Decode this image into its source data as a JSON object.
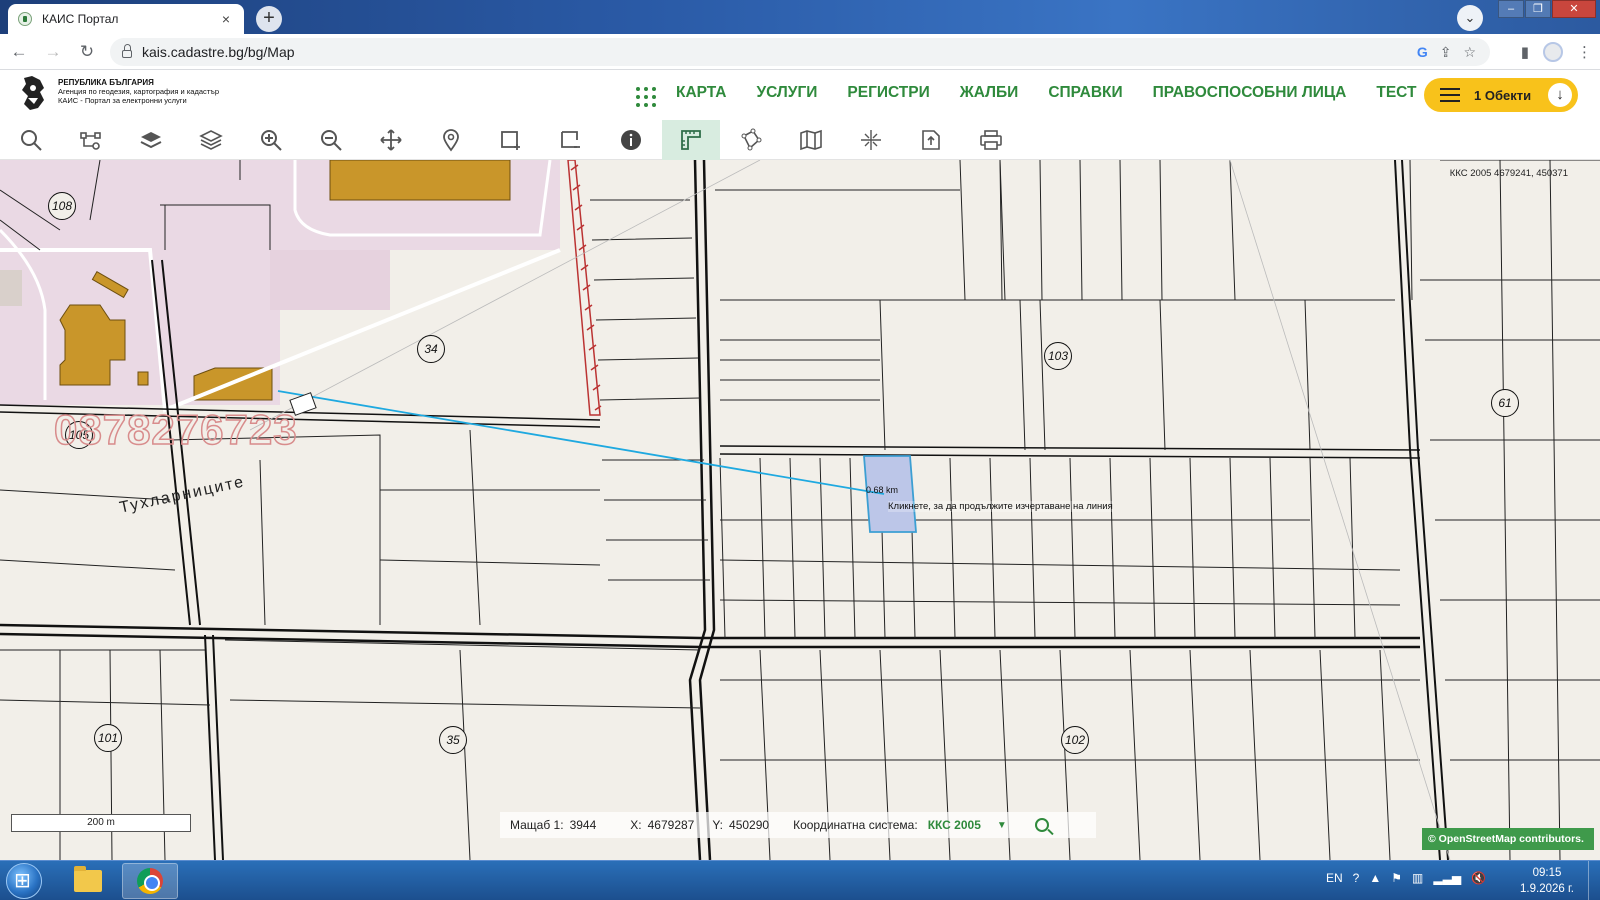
{
  "browser": {
    "tab_title": "КАИС Портал",
    "tab_close": "×",
    "new_tab": "+",
    "tab_search": "⌄",
    "window_controls": [
      "–",
      "❐",
      "✕"
    ],
    "url": "kais.cadastre.bg/bg/Map"
  },
  "site": {
    "logo_line1": "РЕПУБЛИКА БЪЛГАРИЯ",
    "logo_line2": "Агенция по геодезия, картография и кадастър",
    "logo_line3": "КАИС - Портал за електронни услуги",
    "nav": [
      "КАРТА",
      "УСЛУГИ",
      "РЕГИСТРИ",
      "ЖАЛБИ",
      "СПРАВКИ",
      "ПРАВОСПОСОБНИ ЛИЦА",
      "ТЕСТ"
    ],
    "objects_button": "1 Обекти",
    "accent": "#2f8a3c",
    "objects_color": "#f8c21b"
  },
  "toolbar": {
    "tools": [
      {
        "name": "search-tool",
        "icon": "magnifier-icon"
      },
      {
        "name": "route-tool",
        "icon": "nodes-icon"
      },
      {
        "name": "layers-tool",
        "icon": "layers-filled-icon"
      },
      {
        "name": "layers-list-tool",
        "icon": "layers-outline-icon"
      },
      {
        "name": "zoom-in-tool",
        "icon": "zoom-in-icon"
      },
      {
        "name": "zoom-out-tool",
        "icon": "zoom-out-icon"
      },
      {
        "name": "pan-tool",
        "icon": "move-icon"
      },
      {
        "name": "place-marker-tool",
        "icon": "pin-icon"
      },
      {
        "name": "select-add-tool",
        "icon": "select-plus-icon"
      },
      {
        "name": "select-remove-tool",
        "icon": "select-minus-icon"
      },
      {
        "name": "info-tool",
        "icon": "info-icon"
      },
      {
        "name": "measure-tool",
        "icon": "ruler-icon"
      },
      {
        "name": "polygon-tool",
        "icon": "polygon-icon"
      },
      {
        "name": "map-sheets-tool",
        "icon": "map-icon"
      },
      {
        "name": "coordinates-tool",
        "icon": "crosshair-icon"
      },
      {
        "name": "export-tool",
        "icon": "export-icon"
      },
      {
        "name": "print-tool",
        "icon": "printer-icon"
      }
    ],
    "active_index": 11
  },
  "map": {
    "coord_readout": "ККС 2005 4679241, 450371",
    "parcel_numbers": [
      "108",
      "34",
      "105",
      "103",
      "61",
      "101",
      "35",
      "102"
    ],
    "place_name": "Тухларниците",
    "watermark": "0878276723",
    "distance": "0.68 km",
    "hint": "Кликнете, за да продължите изчертаване на линия",
    "scale_bar": "200 m",
    "status": {
      "scale_label": "Мащаб 1:",
      "scale_value": "3944",
      "x_label": "X:",
      "x_value": "4679287",
      "y_label": "Y:",
      "y_value": "450290",
      "system_label": "Координатна система:",
      "system_value": "ККС 2005",
      "dropdown_arrow": "▼"
    },
    "attribution": "© OpenStreetMap contributors."
  },
  "taskbar": {
    "language": "EN",
    "time": "09:15",
    "date": "1.9.2026 г."
  }
}
